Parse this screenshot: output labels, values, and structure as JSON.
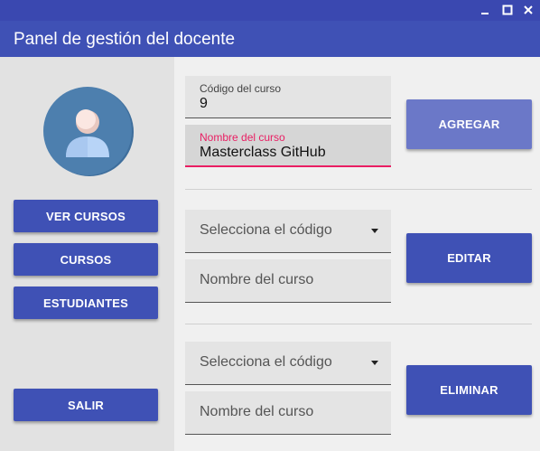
{
  "window": {
    "controls": [
      "minimize-icon",
      "maximize-icon",
      "close-icon"
    ]
  },
  "app": {
    "title": "Panel de gestión del docente"
  },
  "sidebar": {
    "avatar_icon": "user-icon",
    "buttons": [
      "VER CURSOS",
      "CURSOS",
      "ESTUDIANTES"
    ],
    "exit_label": "SALIR"
  },
  "add_section": {
    "code_label": "Código del curso",
    "code_value": "9",
    "name_label": "Nombre del curso",
    "name_value": "Masterclass GitHub",
    "button_label": "AGREGAR"
  },
  "edit_section": {
    "code_placeholder": "Selecciona el código",
    "name_placeholder": "Nombre del curso",
    "button_label": "EDITAR"
  },
  "delete_section": {
    "code_placeholder": "Selecciona el código",
    "name_placeholder": "Nombre del curso",
    "button_label": "ELIMINAR"
  },
  "colors": {
    "primary": "#3f51b5",
    "primary_light": "#6b78c8",
    "accent": "#e91e63",
    "avatar_bg": "#4d7fae"
  }
}
